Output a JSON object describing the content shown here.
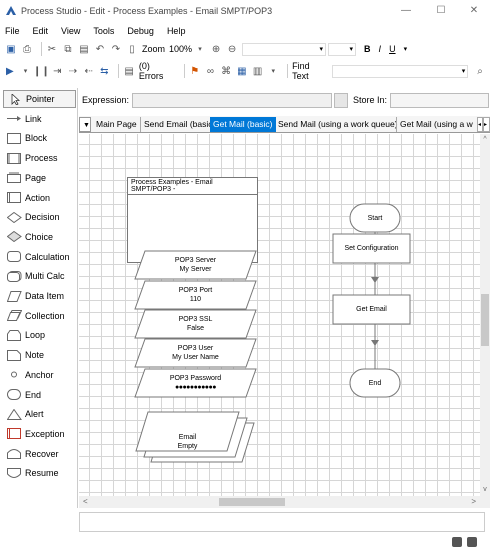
{
  "window": {
    "title": "Process Studio  - Edit - Process Examples - Email SMPT/POP3",
    "controls": [
      "minimize",
      "maximize",
      "close"
    ]
  },
  "menu": [
    {
      "label": "File"
    },
    {
      "label": "Edit"
    },
    {
      "label": "View"
    },
    {
      "label": "Tools"
    },
    {
      "label": "Debug"
    },
    {
      "label": "Help"
    }
  ],
  "toolbar1": {
    "zoom_label": "Zoom",
    "zoom_value": "100%",
    "bold": "B",
    "italic": "I",
    "underline": "U"
  },
  "toolbar2": {
    "errors_label": "(0) Errors",
    "find_label": "Find Text"
  },
  "palette": [
    {
      "label": "Pointer",
      "icon": "pointer-icon",
      "selected": true
    },
    {
      "label": "Link",
      "icon": "link-icon"
    },
    {
      "label": "Block",
      "icon": "block-icon"
    },
    {
      "label": "Process",
      "icon": "process-icon"
    },
    {
      "label": "Page",
      "icon": "page-icon"
    },
    {
      "label": "Action",
      "icon": "action-icon"
    },
    {
      "label": "Decision",
      "icon": "decision-icon"
    },
    {
      "label": "Choice",
      "icon": "choice-icon"
    },
    {
      "label": "Calculation",
      "icon": "calculation-icon"
    },
    {
      "label": "Multi Calc",
      "icon": "multi-calc-icon"
    },
    {
      "label": "Data Item",
      "icon": "data-item-icon"
    },
    {
      "label": "Collection",
      "icon": "collection-icon"
    },
    {
      "label": "Loop",
      "icon": "loop-icon"
    },
    {
      "label": "Note",
      "icon": "note-icon"
    },
    {
      "label": "Anchor",
      "icon": "anchor-icon"
    },
    {
      "label": "End",
      "icon": "end-icon"
    },
    {
      "label": "Alert",
      "icon": "alert-icon"
    },
    {
      "label": "Exception",
      "icon": "exception-icon"
    },
    {
      "label": "Recover",
      "icon": "recover-icon"
    },
    {
      "label": "Resume",
      "icon": "resume-icon"
    }
  ],
  "expression": {
    "label": "Expression:",
    "value": "",
    "store_in_label": "Store In:"
  },
  "tabs": [
    {
      "label": "Main Page"
    },
    {
      "label": "Send Email (basic)"
    },
    {
      "label": "Get Mail (basic)",
      "active": true
    },
    {
      "label": "Send Mail (using a work queue)"
    },
    {
      "label": "Get Mail (using a w"
    }
  ],
  "canvas": {
    "note_title": "Process Examples - Email SMPT/POP3 -",
    "data_items": [
      {
        "name": "POP3 Server",
        "value": "My Server"
      },
      {
        "name": "POP3 Port",
        "value": "110"
      },
      {
        "name": "POP3 SSL",
        "value": "False"
      },
      {
        "name": "POP3 User",
        "value": "My User Name"
      },
      {
        "name": "POP3 Password",
        "value": "●●●●●●●●●●●"
      }
    ],
    "collection": {
      "name": "Email",
      "value": "Empty"
    },
    "flow": {
      "start": "Start",
      "set_config": "Set Configuration",
      "get_email": "Get Email",
      "end": "End"
    }
  },
  "colors": {
    "accent": "#0078d7",
    "grid": "#d6d6d6",
    "exception_red": "#c0392b"
  }
}
